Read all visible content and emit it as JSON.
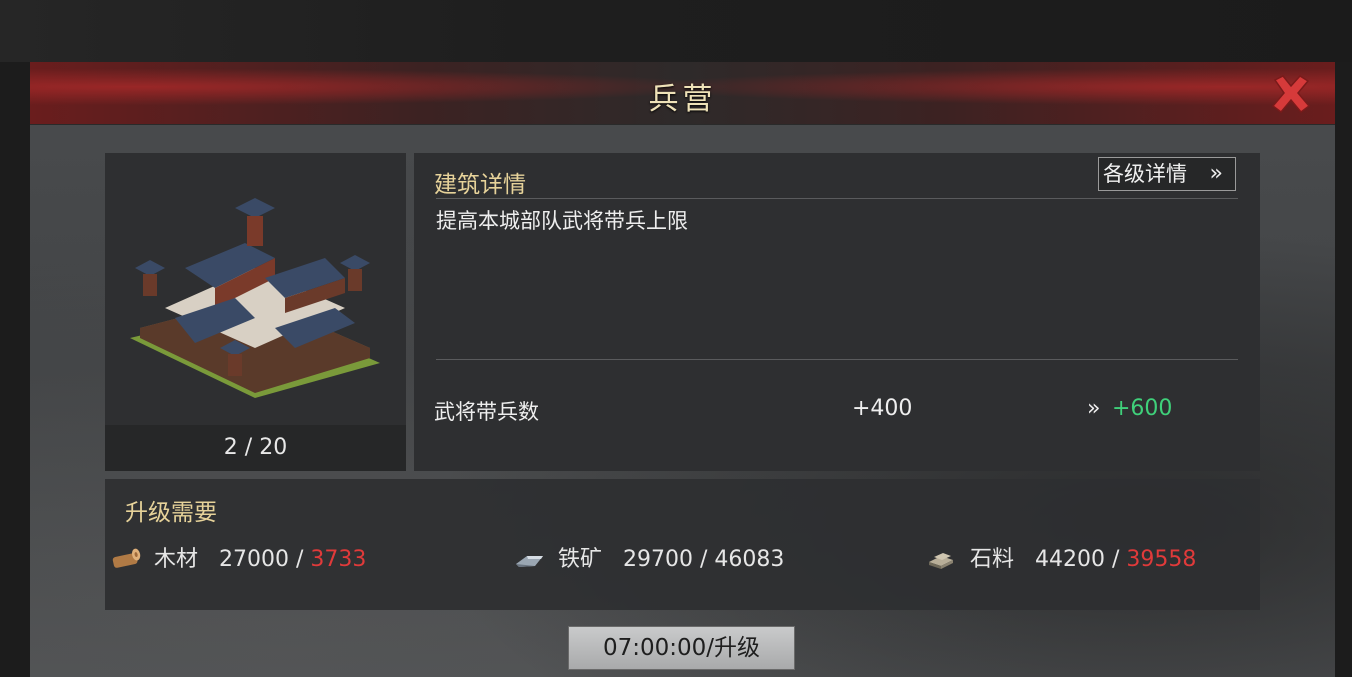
{
  "dialog": {
    "title": "兵营",
    "close_icon": "close-x-icon"
  },
  "building": {
    "image": "barracks-building-icon",
    "level_text": "2 / 20"
  },
  "details": {
    "heading": "建筑详情",
    "levels_button_label": "各级详情",
    "levels_button_icon": "double-chevron-right-icon",
    "description": "提高本城部队武将带兵上限",
    "stat": {
      "label": "武将带兵数",
      "current": "+400",
      "arrow": "»",
      "next": "+600"
    }
  },
  "requirements": {
    "heading": "升级需要",
    "resources": [
      {
        "icon": "wood-log-icon",
        "name": "木材",
        "required": "27000",
        "separator": " / ",
        "owned": "3733",
        "insufficient": true
      },
      {
        "icon": "iron-ore-icon",
        "name": "铁矿",
        "required": "29700",
        "separator": " / ",
        "owned": "46083",
        "insufficient": false
      },
      {
        "icon": "stone-icon",
        "name": "石料",
        "required": "44200",
        "separator": " / ",
        "owned": "39558",
        "insufficient": true
      }
    ]
  },
  "upgrade_button": {
    "label": "07:00:00/升级"
  },
  "colors": {
    "heading": "#e7d39a",
    "increase": "#3fd07a",
    "insufficient": "#e03a3a",
    "close": "#d63a3a"
  }
}
